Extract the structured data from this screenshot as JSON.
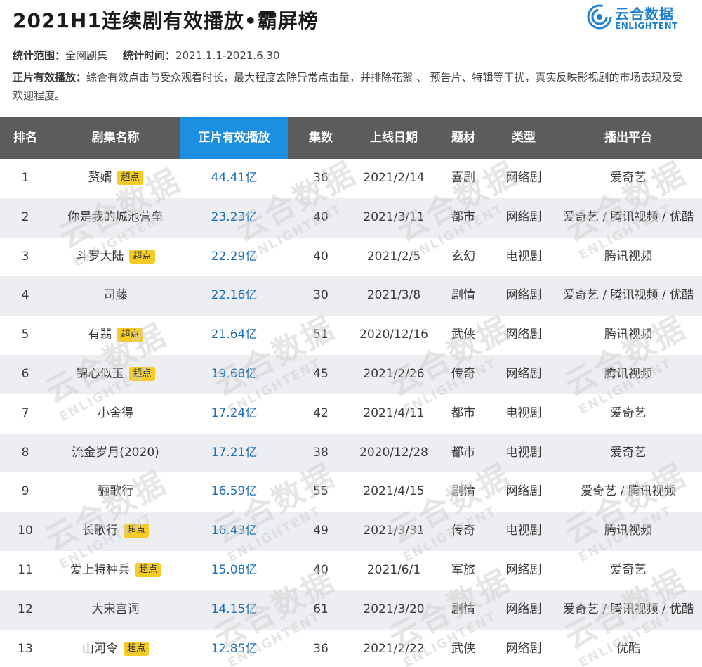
{
  "header": {
    "title": "2021H1连续剧有效播放•霸屏榜",
    "logo_cn": "云合数据",
    "logo_en": "ENLIGHTENT"
  },
  "meta": {
    "scope_label": "统计范围：",
    "scope_value": "全网剧集",
    "time_label": "统计时间：",
    "time_value": "2021.1.1-2021.6.30",
    "def_label": "正片有效播放：",
    "def_value": "综合有效点击与受众观看时长，最大程度去除异常点击量，并排除花絮 、 预告片、特辑等干扰，真实反映影视剧的市场表现及受欢迎程度。"
  },
  "table": {
    "headers": [
      "排名",
      "剧集名称",
      "正片有效播放",
      "集数",
      "上线日期",
      "题材",
      "类型",
      "播出平台"
    ],
    "badge_label": "超点",
    "rows": [
      {
        "rank": "1",
        "name": "赘婿",
        "badge": true,
        "play": "44.41亿",
        "episodes": "36",
        "date": "2021/2/14",
        "genre": "喜剧",
        "type": "网络剧",
        "platform": "爱奇艺"
      },
      {
        "rank": "2",
        "name": "你是我的城池营垒",
        "badge": false,
        "play": "23.23亿",
        "episodes": "40",
        "date": "2021/3/11",
        "genre": "都市",
        "type": "网络剧",
        "platform": "爱奇艺 / 腾讯视频 / 优酷"
      },
      {
        "rank": "3",
        "name": "斗罗大陆",
        "badge": true,
        "play": "22.29亿",
        "episodes": "40",
        "date": "2021/2/5",
        "genre": "玄幻",
        "type": "电视剧",
        "platform": "腾讯视频"
      },
      {
        "rank": "4",
        "name": "司藤",
        "badge": false,
        "play": "22.16亿",
        "episodes": "30",
        "date": "2021/3/8",
        "genre": "剧情",
        "type": "网络剧",
        "platform": "爱奇艺 / 腾讯视频 / 优酷"
      },
      {
        "rank": "5",
        "name": "有翡",
        "badge": true,
        "play": "21.64亿",
        "episodes": "51",
        "date": "2020/12/16",
        "genre": "武侠",
        "type": "网络剧",
        "platform": "腾讯视频"
      },
      {
        "rank": "6",
        "name": "锦心似玉",
        "badge": true,
        "play": "19.68亿",
        "episodes": "45",
        "date": "2021/2/26",
        "genre": "传奇",
        "type": "网络剧",
        "platform": "腾讯视频"
      },
      {
        "rank": "7",
        "name": "小舍得",
        "badge": false,
        "play": "17.24亿",
        "episodes": "42",
        "date": "2021/4/11",
        "genre": "都市",
        "type": "电视剧",
        "platform": "爱奇艺"
      },
      {
        "rank": "8",
        "name": "流金岁月(2020)",
        "badge": false,
        "play": "17.21亿",
        "episodes": "38",
        "date": "2020/12/28",
        "genre": "都市",
        "type": "电视剧",
        "platform": "爱奇艺"
      },
      {
        "rank": "9",
        "name": "骊歌行",
        "badge": false,
        "play": "16.59亿",
        "episodes": "55",
        "date": "2021/4/15",
        "genre": "剧情",
        "type": "网络剧",
        "platform": "爱奇艺 / 腾讯视频"
      },
      {
        "rank": "10",
        "name": "长歌行",
        "badge": true,
        "play": "16.43亿",
        "episodes": "49",
        "date": "2021/3/31",
        "genre": "传奇",
        "type": "电视剧",
        "platform": "腾讯视频"
      },
      {
        "rank": "11",
        "name": "爱上特种兵",
        "badge": true,
        "play": "15.08亿",
        "episodes": "40",
        "date": "2021/6/1",
        "genre": "军旅",
        "type": "网络剧",
        "platform": "爱奇艺"
      },
      {
        "rank": "12",
        "name": "大宋宫词",
        "badge": false,
        "play": "14.15亿",
        "episodes": "61",
        "date": "2021/3/20",
        "genre": "剧情",
        "type": "网络剧",
        "platform": "爱奇艺 / 腾讯视频 / 优酷"
      },
      {
        "rank": "13",
        "name": "山河令",
        "badge": true,
        "play": "12.85亿",
        "episodes": "36",
        "date": "2021/2/22",
        "genre": "武侠",
        "type": "网络剧",
        "platform": "优酷"
      }
    ]
  },
  "colors": {
    "header_bg": "#5c5c5c",
    "header_highlight": "#1d8fe0",
    "play_text": "#1d6fb8",
    "badge_bg": "#f5cc25",
    "row_alt": "#eceef1",
    "brand": "#1d7fd2"
  }
}
